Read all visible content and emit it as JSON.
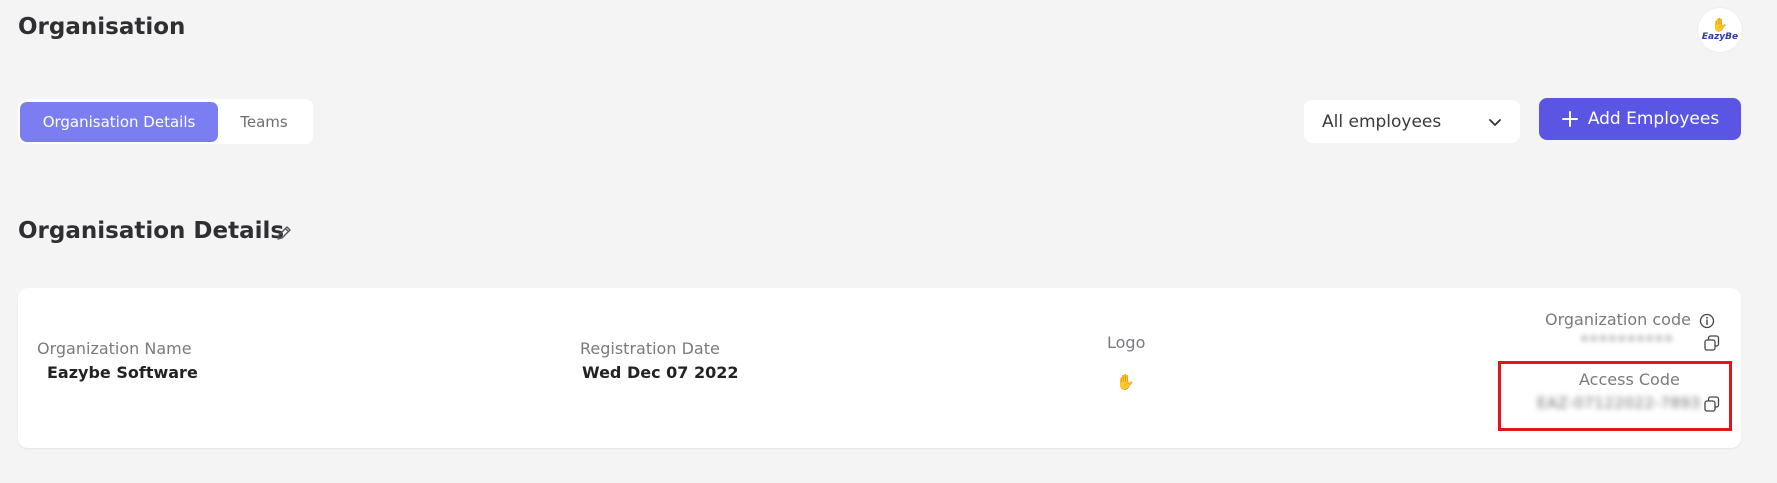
{
  "header": {
    "title": "Organisation",
    "brand_name": "EazyBe"
  },
  "tabs": [
    {
      "label": "Organisation Details",
      "active": true
    },
    {
      "label": "Teams",
      "active": false
    }
  ],
  "filter": {
    "selected": "All employees"
  },
  "add_button": {
    "label": "Add Employees"
  },
  "section": {
    "title": "Organisation Details"
  },
  "details": {
    "org_name_label": "Organization Name",
    "org_name_value": "Eazybe Software",
    "reg_date_label": "Registration Date",
    "reg_date_value": "Wed Dec 07 2022",
    "logo_label": "Logo",
    "org_code_label": "Organization code",
    "org_code_value": "••••••••••",
    "access_code_label": "Access Code",
    "access_code_value": "EAZ-07122022-7893"
  },
  "colors": {
    "accent": "#5a55e3",
    "active_tab": "#7b7ef0",
    "highlight": "#e2141c"
  }
}
